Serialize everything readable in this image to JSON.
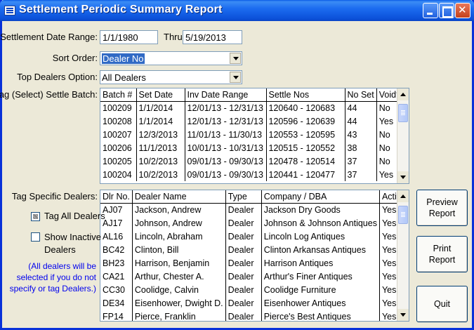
{
  "window": {
    "title": "Settlement Periodic Summary Report"
  },
  "date_range": {
    "label": "Settlement Date Range:",
    "from": "1/1/1980",
    "thru_label": "Thru",
    "to": "5/19/2013"
  },
  "sort_order": {
    "label": "Sort Order:",
    "value": "Dealer No"
  },
  "top_dealers": {
    "label": "Top Dealers Option:",
    "value": "All Dealers"
  },
  "batch_grid": {
    "label": "Tag (Select) Settle Batch:",
    "columns": [
      "Batch #",
      "Set Date",
      "Inv Date Range",
      "Settle Nos",
      "No Set",
      "Void?"
    ],
    "rows": [
      [
        "100209",
        "1/1/2014",
        "12/01/13 - 12/31/13",
        "120640 - 120683",
        "44",
        "No"
      ],
      [
        "100208",
        "1/1/2014",
        "12/01/13 - 12/31/13",
        "120596 - 120639",
        "44",
        "Yes"
      ],
      [
        "100207",
        "12/3/2013",
        "11/01/13 - 11/30/13",
        "120553 - 120595",
        "43",
        "No"
      ],
      [
        "100206",
        "11/1/2013",
        "10/01/13 - 10/31/13",
        "120515 - 120552",
        "38",
        "No"
      ],
      [
        "100205",
        "10/2/2013",
        "09/01/13 - 09/30/13",
        "120478 - 120514",
        "37",
        "No"
      ],
      [
        "100204",
        "10/2/2013",
        "09/01/13 - 09/30/13",
        "120441 - 120477",
        "37",
        "Yes"
      ]
    ]
  },
  "dealer_grid": {
    "label": "Tag Specific Dealers:",
    "columns": [
      "Dlr No.",
      "Dealer Name",
      "Type",
      "Company / DBA",
      "Active"
    ],
    "rows": [
      [
        "AJ07",
        "Jackson, Andrew",
        "Dealer",
        "Jackson Dry Goods",
        "Yes"
      ],
      [
        "AJ17",
        "Johnson, Andrew",
        "Dealer",
        "Johnson & Johnson Antiques",
        "Yes"
      ],
      [
        "AL16",
        "Lincoln, Abraham",
        "Dealer",
        "Lincoln Log Antiques",
        "Yes"
      ],
      [
        "BC42",
        "Clinton, Bill",
        "Dealer",
        "Clinton Arkansas Antiques",
        "Yes"
      ],
      [
        "BH23",
        "Harrison, Benjamin",
        "Dealer",
        "Harrison Antiques",
        "Yes"
      ],
      [
        "CA21",
        "Arthur, Chester A.",
        "Dealer",
        "Arthur's Finer Antiques",
        "Yes"
      ],
      [
        "CC30",
        "Coolidge, Calvin",
        "Dealer",
        "Coolidge Furniture",
        "Yes"
      ],
      [
        "DE34",
        "Eisenhower, Dwight D.",
        "Dealer",
        "Eisenhower Antiques",
        "Yes"
      ],
      [
        "FP14",
        "Pierce, Franklin",
        "Dealer",
        "Pierce's Best Antiques",
        "Yes"
      ]
    ]
  },
  "options": {
    "tag_all_dealers": "Tag All Dealers",
    "tag_all_checked": true,
    "show_inactive": "Show Inactive\nDealers",
    "show_inactive_checked": false,
    "note": "(All dealers will be\nselected if you do not\nspecify or tag Dealers.)"
  },
  "buttons": {
    "preview": "Preview\nReport",
    "print": "Print\nReport",
    "quit": "Quit"
  }
}
